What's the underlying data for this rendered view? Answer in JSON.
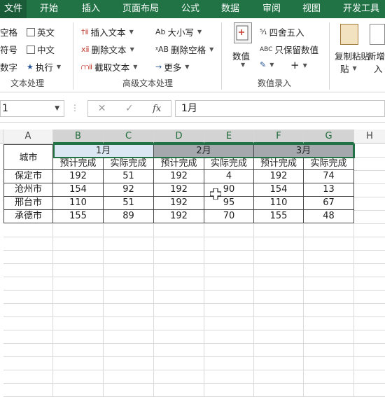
{
  "tabs": [
    {
      "label": "文件",
      "active": true
    },
    {
      "label": "开始"
    },
    {
      "label": "插入"
    },
    {
      "label": "页面布局"
    },
    {
      "label": "公式"
    },
    {
      "label": "数据"
    },
    {
      "label": "审阅"
    },
    {
      "label": "视图"
    },
    {
      "label": "开发工具"
    }
  ],
  "ribbon": {
    "g1": {
      "items": [
        "空格",
        "英文",
        "符号",
        "中文",
        "数字",
        "执行"
      ],
      "label": "文本处理"
    },
    "g2": {
      "items": [
        "插入文本",
        "大小写",
        "删除文本",
        "删除空格",
        "截取文本",
        "更多"
      ],
      "label": "高级文本处理"
    },
    "g3": {
      "items": [
        "数值",
        "四舍五入",
        "只保留数值"
      ],
      "label": "数值录入"
    },
    "g4": {
      "copy": "复制粘贴",
      "copy2": "贴",
      "new": "新增",
      "new2": "入"
    }
  },
  "formula_bar": {
    "name_box": "1",
    "content": "1月",
    "fx": "fx"
  },
  "columns": [
    "A",
    "B",
    "C",
    "D",
    "E",
    "F",
    "G",
    "H"
  ],
  "table": {
    "city_header": "城市",
    "months": [
      "1月",
      "2月",
      "3月"
    ],
    "sub_headers": [
      "预计完成",
      "实际完成",
      "预计完成",
      "实际完成",
      "预计完成",
      "实际完成"
    ],
    "rows": [
      {
        "city": "保定市",
        "values": [
          "192",
          "51",
          "192",
          "4",
          "192",
          "74"
        ]
      },
      {
        "city": "沧州市",
        "values": [
          "154",
          "92",
          "192",
          "90",
          "154",
          "13"
        ]
      },
      {
        "city": "邢台市",
        "values": [
          "110",
          "51",
          "192",
          "95",
          "110",
          "67"
        ]
      },
      {
        "city": "承德市",
        "values": [
          "155",
          "89",
          "192",
          "70",
          "155",
          "48"
        ]
      }
    ]
  },
  "colors": {
    "ribbon_green": "#217346",
    "month1_fill": "#dbe8f3",
    "selected_month_fill": "#a5a9ad"
  }
}
